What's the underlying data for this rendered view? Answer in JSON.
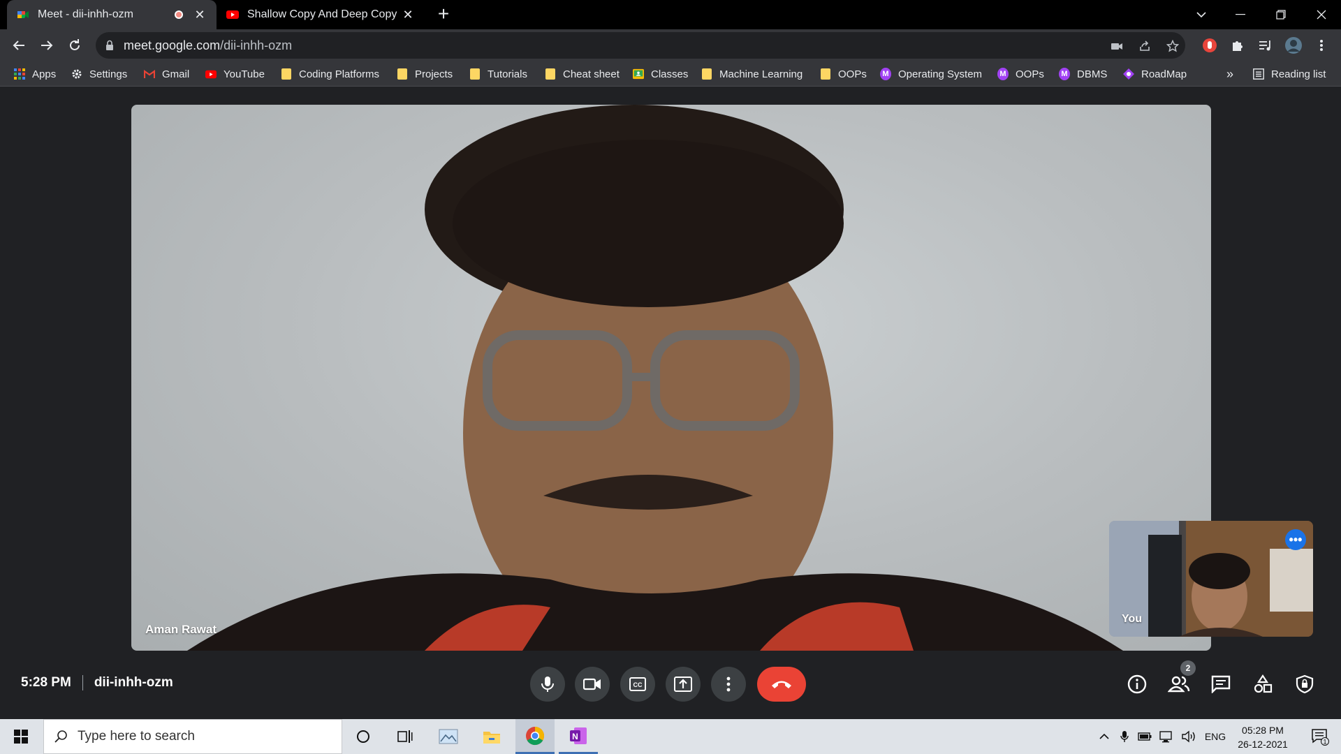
{
  "tabs": [
    {
      "title": "Meet - dii-inhh-ozm"
    },
    {
      "title": "Shallow Copy And Deep Copy In"
    }
  ],
  "address": {
    "host": "meet.google.com",
    "path": "/dii-inhh-ozm"
  },
  "bookmarks": {
    "items": [
      {
        "label": "Apps",
        "icon": "apps-grid-icon"
      },
      {
        "label": "Settings",
        "icon": "gear-icon"
      },
      {
        "label": "Gmail",
        "icon": "gmail-icon"
      },
      {
        "label": "YouTube",
        "icon": "youtube-icon"
      },
      {
        "label": "Coding Platforms",
        "icon": "folder-icon"
      },
      {
        "label": "Projects",
        "icon": "folder-icon"
      },
      {
        "label": "Tutorials",
        "icon": "folder-icon"
      },
      {
        "label": "Cheat sheet",
        "icon": "folder-icon"
      },
      {
        "label": "Classes",
        "icon": "classroom-icon"
      },
      {
        "label": "Machine Learning",
        "icon": "folder-icon"
      },
      {
        "label": "OOPs",
        "icon": "folder-icon"
      },
      {
        "label": "Operating System",
        "icon": "m-circle-icon"
      },
      {
        "label": "OOPs",
        "icon": "m-circle-icon"
      },
      {
        "label": "DBMS",
        "icon": "m-circle-icon"
      },
      {
        "label": "RoadMap",
        "icon": "roadmap-icon"
      }
    ],
    "overflow": "»",
    "reading_list": "Reading list"
  },
  "meet": {
    "main_participant": "Aman Rawat",
    "self_label": "You",
    "time": "5:28 PM",
    "meeting_code": "dii-inhh-ozm",
    "people_count": "2"
  },
  "taskbar": {
    "search_placeholder": "Type here to search",
    "language": "ENG",
    "time": "05:28 PM",
    "date": "26-12-2021",
    "notifications": "1"
  },
  "colors": {
    "hangup": "#ea4335",
    "accent": "#1a73e8",
    "meet_bg": "#202124"
  }
}
